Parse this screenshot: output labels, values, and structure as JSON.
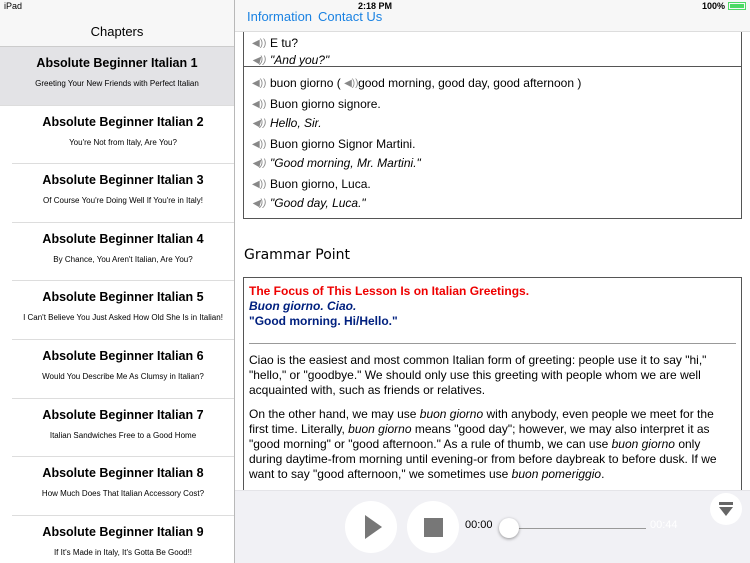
{
  "status": {
    "device": "iPad",
    "time": "2:18 PM",
    "battery": "100%"
  },
  "sidebar": {
    "title": "Chapters",
    "items": [
      {
        "title": "Absolute Beginner Italian 1",
        "subtitle": "Greeting Your New Friends with Perfect Italian"
      },
      {
        "title": "Absolute Beginner Italian 2",
        "subtitle": "You're Not from Italy, Are You?"
      },
      {
        "title": "Absolute Beginner Italian 3",
        "subtitle": "Of Course You're Doing Well If You're in Italy!"
      },
      {
        "title": "Absolute Beginner Italian 4",
        "subtitle": "By Chance, You Aren't Italian, Are You?"
      },
      {
        "title": "Absolute Beginner Italian 5",
        "subtitle": "I Can't Believe You Just Asked How Old She Is in Italian!"
      },
      {
        "title": "Absolute Beginner Italian 6",
        "subtitle": "Would You Describe Me As Clumsy in Italian?"
      },
      {
        "title": "Absolute Beginner Italian 7",
        "subtitle": "Italian Sandwiches Free to a Good Home"
      },
      {
        "title": "Absolute Beginner Italian 8",
        "subtitle": "How Much Does That Italian Accessory Cost?"
      },
      {
        "title": "Absolute Beginner Italian 9",
        "subtitle": "If It's Made in Italy, It's Gotta Be Good!!"
      }
    ]
  },
  "nav": {
    "information": "Information",
    "contact": "Contact Us"
  },
  "vocab": {
    "top": [
      "E tu?",
      "\"And you?\""
    ],
    "headword": "buon giorno (",
    "meaning": "good morning, good day, good afternoon )",
    "examples": [
      "Buon giorno signore.",
      "Hello, Sir.",
      "Buon giorno Signor Martini.",
      "\"Good morning, Mr. Martini.\"",
      "Buon giorno, Luca.",
      "\"Good day, Luca.\""
    ]
  },
  "grammar": {
    "heading": "Grammar Point",
    "focus": "The Focus of This Lesson Is on Italian Greetings.",
    "italian": "Buon giorno. Ciao.",
    "english": "\"Good morning. Hi/Hello.\"",
    "p1": "Ciao is the easiest and most common Italian form of greeting: people use it to say \"hi,\" \"hello,\" or \"goodbye.\" We should only use this greeting with people whom we are well acquainted with, such as friends or relatives.",
    "p2a": "On the other hand, we may use ",
    "p2b": "buon giorno",
    "p2c": " with anybody, even people we meet for the first time. Literally, ",
    "p2d": "buon giorno",
    "p2e": " means \"good day\"; however, we may also interpret it as \"good morning\" or \"good afternoon.\" As a rule of thumb, we can use ",
    "p2f": "buon giorno",
    "p2g": " only during daytime-from morning until evening-or from before daybreak to before dusk. If we want to say \"good afternoon,\" we sometimes use ",
    "p2h": "buon pomeriggio",
    "p2i": "."
  },
  "player": {
    "current": "00:00",
    "duration": "00:44",
    "progress": 0
  }
}
